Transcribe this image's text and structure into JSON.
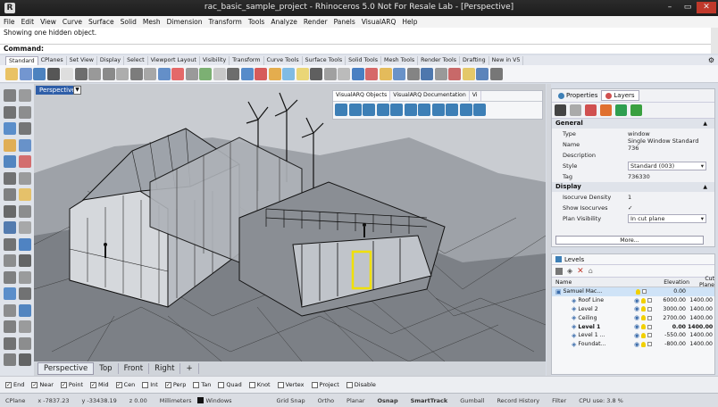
{
  "window": {
    "title": "rac_basic_sample_project - Rhinoceros 5.0 Not For Resale Lab - [Perspective]",
    "min": "–",
    "max": "▭",
    "close": "✕"
  },
  "menu": [
    "File",
    "Edit",
    "View",
    "Curve",
    "Surface",
    "Solid",
    "Mesh",
    "Dimension",
    "Transform",
    "Tools",
    "Analyze",
    "Render",
    "Panels",
    "VisualARQ",
    "Help"
  ],
  "command": {
    "history": "Showing one hidden object.",
    "prompt": "Command:"
  },
  "toolbar_tabs": [
    "Standard",
    "CPlanes",
    "Set View",
    "Display",
    "Select",
    "Viewport Layout",
    "Visibility",
    "Transform",
    "Curve Tools",
    "Surface Tools",
    "Solid Tools",
    "Mesh Tools",
    "Render Tools",
    "Drafting",
    "New in V5"
  ],
  "viewport": {
    "title": "Perspective",
    "tabs": [
      "Perspective",
      "Top",
      "Front",
      "Right"
    ],
    "add_tab": "+"
  },
  "vaq_panel": {
    "tabs": [
      "VisualARQ Objects",
      "VisualARQ Documentation",
      "Vi"
    ]
  },
  "properties": {
    "tabs": [
      "Properties",
      "Layers"
    ],
    "general_label": "General",
    "display_label": "Display",
    "general": [
      {
        "k": "Type",
        "v": "window"
      },
      {
        "k": "Name",
        "v": "Single Window Standard 736"
      },
      {
        "k": "Description",
        "v": ""
      },
      {
        "k": "Style",
        "v": "Standard (003)"
      },
      {
        "k": "Tag",
        "v": "736330"
      }
    ],
    "display": [
      {
        "k": "Isocurve Density",
        "v": "1"
      },
      {
        "k": "Show Isocurves",
        "v": "✓"
      },
      {
        "k": "Plan Visibility",
        "v": "In cut plane"
      }
    ],
    "more": "More..."
  },
  "layers": {
    "title": "Levels",
    "col_name": "Name",
    "col_elev": "Elevation",
    "col_cut": "Cut Plane",
    "rows": [
      {
        "name": "Samuel Mac...",
        "elev": "0.00",
        "cut": "",
        "indent": 0,
        "sel": true,
        "bold": false
      },
      {
        "name": "Roof Line",
        "elev": "6000.00",
        "cut": "1400.00",
        "indent": 1,
        "sel": false,
        "bold": false
      },
      {
        "name": "Level 2",
        "elev": "3000.00",
        "cut": "1400.00",
        "indent": 1,
        "sel": false,
        "bold": false
      },
      {
        "name": "Ceiling",
        "elev": "2700.00",
        "cut": "1400.00",
        "indent": 1,
        "sel": false,
        "bold": false
      },
      {
        "name": "Level 1",
        "elev": "0.00",
        "cut": "1400.00",
        "indent": 1,
        "sel": false,
        "bold": true
      },
      {
        "name": "Level 1 ...",
        "elev": "-550.00",
        "cut": "1400.00",
        "indent": 1,
        "sel": false,
        "bold": false
      },
      {
        "name": "Foundat...",
        "elev": "-800.00",
        "cut": "1400.00",
        "indent": 1,
        "sel": false,
        "bold": false
      }
    ]
  },
  "osnaps": [
    {
      "label": "End",
      "on": true
    },
    {
      "label": "Near",
      "on": true
    },
    {
      "label": "Point",
      "on": true
    },
    {
      "label": "Mid",
      "on": true
    },
    {
      "label": "Cen",
      "on": true
    },
    {
      "label": "Int",
      "on": false
    },
    {
      "label": "Perp",
      "on": true
    },
    {
      "label": "Tan",
      "on": false
    },
    {
      "label": "Quad",
      "on": false
    },
    {
      "label": "Knot",
      "on": false
    },
    {
      "label": "Vertex",
      "on": false
    },
    {
      "label": "Project",
      "on": false
    },
    {
      "label": "Disable",
      "on": false
    }
  ],
  "status": {
    "cplane": "CPlane",
    "x": "x -7837.23",
    "y": "y -33438.19",
    "z": "z 0.00",
    "units": "Millimeters",
    "layer": "Windows",
    "items": [
      {
        "label": "Grid Snap",
        "bold": false
      },
      {
        "label": "Ortho",
        "bold": false
      },
      {
        "label": "Planar",
        "bold": false
      },
      {
        "label": "Osnap",
        "bold": true
      },
      {
        "label": "SmartTrack",
        "bold": true
      },
      {
        "label": "Gumball",
        "bold": false
      },
      {
        "label": "Record History",
        "bold": false
      },
      {
        "label": "Filter",
        "bold": false
      }
    ],
    "cpu": "CPU use: 3.8 %"
  },
  "colors": {
    "viewport_title": "#2f5ea8",
    "selection": "#f0e000",
    "accent": "#3d7fb6"
  }
}
